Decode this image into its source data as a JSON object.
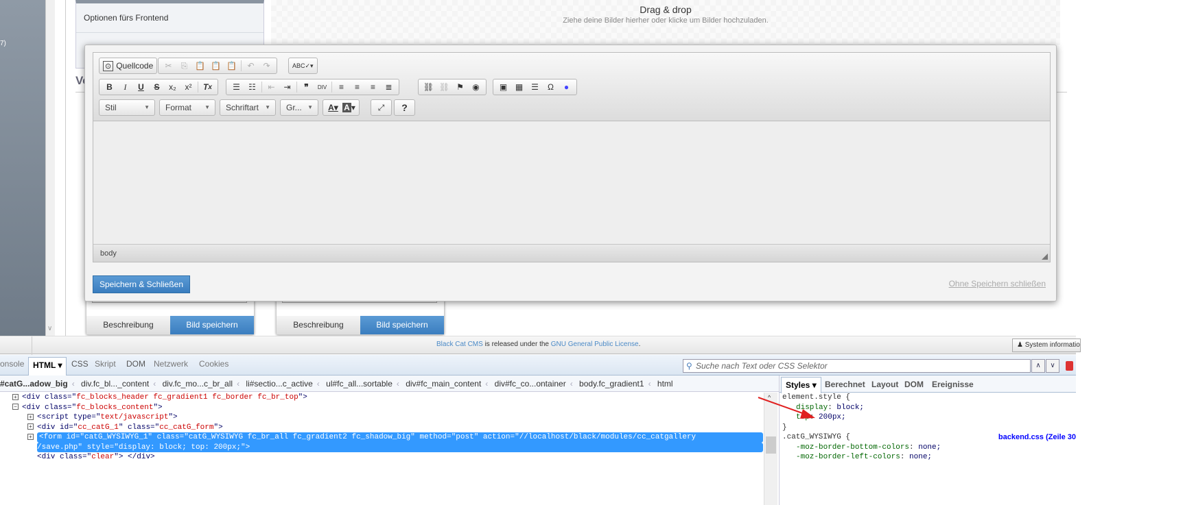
{
  "sidebar": {
    "count_fragment": "7)",
    "scroll_down": "∨"
  },
  "panel": {
    "options_label": "Optionen fürs Frontend"
  },
  "dropzone": {
    "title": "Drag & drop",
    "subtitle": "Ziehe deine Bilder hierher oder klicke um Bilder hochzuladen."
  },
  "section_heading": "Vo",
  "cards": [
    {
      "tab1": "Beschreibung",
      "tab2": "Bild speichern"
    },
    {
      "tab1": "Beschreibung",
      "tab2": "Bild speichern"
    }
  ],
  "editor": {
    "source_label": "Quellcode",
    "combos": [
      "Stil",
      "Format",
      "Schriftart",
      "Gr..."
    ],
    "path": "body",
    "save_label": "Speichern & Schließen",
    "cancel_label": "Ohne Speichern schließen"
  },
  "footer": {
    "brand": "Black Cat CMS",
    "middle": " is released under the ",
    "license": "GNU General Public License",
    "end": ".",
    "sysinfo": "System information"
  },
  "devtools": {
    "tabs": [
      "onsole",
      "HTML ▾",
      "CSS",
      "Skript",
      "DOM",
      "Netzwerk",
      "Cookies"
    ],
    "search_placeholder": "Suche nach Text oder CSS Selektor",
    "breadcrumbs": [
      "#catG...adow_big",
      "div.fc_bl..._content",
      "div.fc_mo...c_br_all",
      "li#sectio...c_active",
      "ul#fc_all...sortable",
      "div#fc_main_content",
      "div#fc_co...ontainer",
      "body.fc_gradient1",
      "html"
    ],
    "style_tabs": [
      "Styles ▾",
      "Berechnet",
      "Layout",
      "DOM",
      "Ereignisse"
    ],
    "html_lines": [
      {
        "pre": "<div class=\"",
        "val": "fc_blocks_header fc_gradient1 fc_border fc_br_top",
        "post": "\">"
      },
      {
        "pre": "<div class=\"",
        "val": "fc_blocks_content",
        "post": "\">"
      },
      {
        "pre": "<script type=\"",
        "val": "text/javascript",
        "post": "\">"
      },
      {
        "pre": "<div id=\"",
        "val": "cc_catG_1",
        "mid": "\" class=\"",
        "val2": "cc_catG_form",
        "post": "\">"
      },
      {
        "text": "<form id=\"catG_WYSIWYG_1\" class=\"catG_WYSIWYG fc_br_all fc_gradient2 fc_shadow_big\" method=\"post\" action=\"//localhost/black/modules/cc_catgallery"
      },
      {
        "text": "/save.php\" style=\"display: block; top: 200px;\">"
      },
      {
        "pre": "<div class=\"",
        "val": "clear",
        "post": "\"> </div>"
      }
    ],
    "styles": {
      "rule1": "element.style {",
      "p1": "display",
      "v1": "block;",
      "p2": "top",
      "v2": "200px;",
      "close": "}",
      "rule2": ".catG_WYSIWYG {",
      "src2": "backend.css (Zeile 30",
      "p3": "-moz-border-bottom-colors",
      "v3": "none;",
      "p4": "-moz-border-left-colors",
      "v4": "none;"
    }
  },
  "colors": {
    "accent": "#3a7dbf",
    "selection": "#3399ff",
    "annotation_arrow": "#e02020"
  }
}
